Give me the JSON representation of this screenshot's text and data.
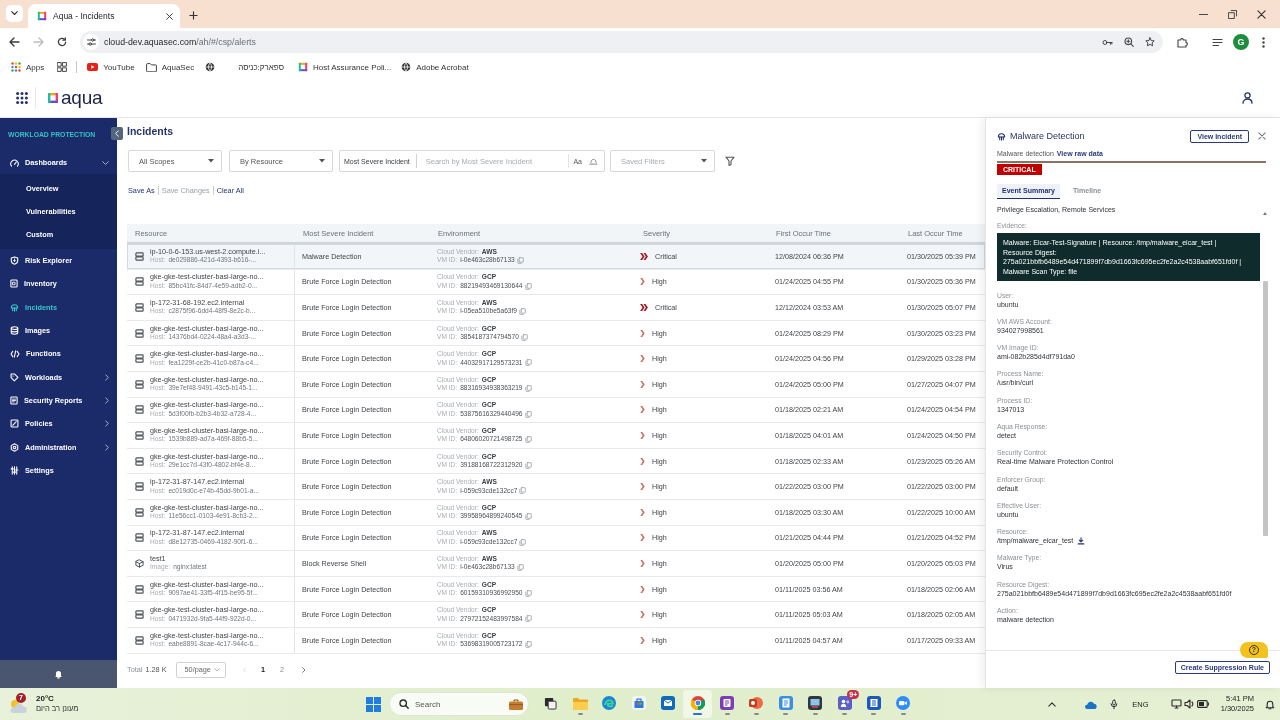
{
  "browser": {
    "tabs": [
      {
        "title": "Aqua - Incidents",
        "selected": true
      }
    ],
    "back_disabled": false,
    "forward_disabled": true,
    "address": {
      "host": "cloud-dev.aquasec.com",
      "path": "/ah/#/csp/alerts"
    },
    "profile_initial": "G",
    "bookmarks": [
      {
        "label": "Apps"
      },
      {
        "label": "YouTube"
      },
      {
        "label": "AquaSec"
      },
      {
        "label": "ספארק:כניסה"
      },
      {
        "label": "Host Assurance Poli..."
      },
      {
        "label": "Adobe Acrobat"
      }
    ]
  },
  "app": {
    "logo": "aqua"
  },
  "sidebar": {
    "section": "WORKLOAD PROTECTION",
    "items": [
      {
        "label": "Dashboards",
        "selected": false,
        "expanded": true,
        "children": [
          {
            "label": "Overview",
            "selected": false
          },
          {
            "label": "Vulnerabilities",
            "selected": false
          },
          {
            "label": "Custom",
            "selected": false
          }
        ]
      },
      {
        "label": "Risk Explorer",
        "selected": false
      },
      {
        "label": "Inventory",
        "selected": false
      },
      {
        "label": "Incidents",
        "selected": true
      },
      {
        "label": "Images",
        "selected": false
      },
      {
        "label": "Functions",
        "selected": false
      },
      {
        "label": "Workloads",
        "selected": false,
        "expanded": false
      },
      {
        "label": "Security Reports",
        "selected": false,
        "expanded": false
      },
      {
        "label": "Policies",
        "selected": false,
        "expanded": false
      },
      {
        "label": "Administration",
        "selected": false,
        "expanded": false
      },
      {
        "label": "Settings",
        "selected": false
      }
    ]
  },
  "incidents": {
    "title": "Incidents",
    "filters": {
      "scope": "All Scopes",
      "group_by": "By Resource",
      "search_field": "Most Severe Incident",
      "search_placeholder": "Search by Most Severe Incident",
      "match_case": "Aa",
      "saved_filters_placeholder": "Saved Filters"
    },
    "actions": [
      {
        "label": "Save As",
        "disabled": false
      },
      {
        "label": "Save Changes",
        "disabled": true
      },
      {
        "label": "Clear All",
        "disabled": false
      }
    ],
    "table": {
      "columns": [
        "Resource",
        "Most Severe Incident",
        "Environment",
        "Severity",
        "First Occur Time",
        "Last Occur Time"
      ],
      "rows": [
        {
          "selected": true,
          "resource": {
            "kind": "host",
            "name": "ip-10-0-6-153.us-west-2.compute.i...",
            "detail_label": "Host:",
            "detail": "de029886-421d-4393-b616-..."
          },
          "incident": "Malware Detection",
          "environment": {
            "vendor_label": "Cloud Vendor:",
            "vendor": "AWS",
            "id_label": "VM ID:",
            "id": "i-0e463c28b67133"
          },
          "severity": {
            "kind": "critical",
            "label": "Critical"
          },
          "first_occur": "12/08/2024 06:36 PM",
          "last_occur": "01/30/2025 05:39 PM"
        },
        {
          "selected": false,
          "resource": {
            "kind": "host",
            "name": "gke-gke-test-cluster-basi-large-no...",
            "detail_label": "Host:",
            "detail": "85bc41fc-84d7-4e59-adb2-0..."
          },
          "incident": "Brute Force Login Detection",
          "environment": {
            "vendor_label": "Cloud Vendor:",
            "vendor": "GCP",
            "id_label": "VM ID:",
            "id": "88219493469130644"
          },
          "severity": {
            "kind": "high",
            "label": "High"
          },
          "first_occur": "01/24/2025 04:55 PM",
          "last_occur": "01/30/2025 05:36 PM"
        },
        {
          "selected": false,
          "resource": {
            "kind": "host",
            "name": "ip-172-31-68-192.ec2.internal",
            "detail_label": "Host:",
            "detail": "c2875f96-6dd4-48f9-8e2c-b..."
          },
          "incident": "Brute Force Login Detection",
          "environment": {
            "vendor_label": "Cloud Vendor:",
            "vendor": "AWS",
            "id_label": "VM ID:",
            "id": "i-05ea510be5a63f9"
          },
          "severity": {
            "kind": "critical",
            "label": "Critical"
          },
          "first_occur": "12/12/2024 03:53 AM",
          "last_occur": "01/30/2025 05:07 PM"
        },
        {
          "selected": false,
          "resource": {
            "kind": "host",
            "name": "gke-gke-test-cluster-basi-large-no...",
            "detail_label": "Host:",
            "detail": "14376bd4-0224-48a4-a3d3-..."
          },
          "incident": "Brute Force Login Detection",
          "environment": {
            "vendor_label": "Cloud Vendor:",
            "vendor": "GCP",
            "id_label": "VM ID:",
            "id": "3854187374794570"
          },
          "severity": {
            "kind": "high",
            "label": "High"
          },
          "first_occur": "01/24/2025 08:29 PM",
          "last_occur": "01/30/2025 03:23 PM"
        },
        {
          "selected": false,
          "resource": {
            "kind": "host",
            "name": "gke-gke-test-cluster-basi-large-no...",
            "detail_label": "Host:",
            "detail": "fea1229f-ce2b-41c0-b87a-c4..."
          },
          "incident": "Brute Force Login Detection",
          "environment": {
            "vendor_label": "Cloud Vendor:",
            "vendor": "GCP",
            "id_label": "VM ID:",
            "id": "44032917129573231"
          },
          "severity": {
            "kind": "high",
            "label": "High"
          },
          "first_occur": "01/24/2025 04:56 PM",
          "last_occur": "01/29/2025 03:28 PM"
        },
        {
          "selected": false,
          "resource": {
            "kind": "host",
            "name": "gke-gke-test-cluster-basi-large-no...",
            "detail_label": "Host:",
            "detail": "39e7ef48-9491-43c5-b145-1..."
          },
          "incident": "Brute Force Login Detection",
          "environment": {
            "vendor_label": "Cloud Vendor:",
            "vendor": "GCP",
            "id_label": "VM ID:",
            "id": "88316934938363219"
          },
          "severity": {
            "kind": "high",
            "label": "High"
          },
          "first_occur": "01/24/2025 05:00 PM",
          "last_occur": "01/27/2025 04:07 PM"
        },
        {
          "selected": false,
          "resource": {
            "kind": "host",
            "name": "gke-gke-test-cluster-basi-large-no...",
            "detail_label": "Host:",
            "detail": "5d3f00fb-b2b3-4b32-a728-4..."
          },
          "incident": "Brute Force Login Detection",
          "environment": {
            "vendor_label": "Cloud Vendor:",
            "vendor": "GCP",
            "id_label": "VM ID:",
            "id": "53875616329440496"
          },
          "severity": {
            "kind": "high",
            "label": "High"
          },
          "first_occur": "01/18/2025 02:21 AM",
          "last_occur": "01/24/2025 04:54 PM"
        },
        {
          "selected": false,
          "resource": {
            "kind": "host",
            "name": "gke-gke-test-cluster-basi-large-no...",
            "detail_label": "Host:",
            "detail": "1539b889-ad7a-469f-88b5-5..."
          },
          "incident": "Brute Force Login Detection",
          "environment": {
            "vendor_label": "Cloud Vendor:",
            "vendor": "GCP",
            "id_label": "VM ID:",
            "id": "64806020721498725"
          },
          "severity": {
            "kind": "high",
            "label": "High"
          },
          "first_occur": "01/18/2025 04:01 AM",
          "last_occur": "01/24/2025 04:50 PM"
        },
        {
          "selected": false,
          "resource": {
            "kind": "host",
            "name": "gke-gke-test-cluster-basi-large-no...",
            "detail_label": "Host:",
            "detail": "29e1cc7d-43f0-4802-bf4e-8..."
          },
          "incident": "Brute Force Login Detection",
          "environment": {
            "vendor_label": "Cloud Vendor:",
            "vendor": "GCP",
            "id_label": "VM ID:",
            "id": "39188168722312920"
          },
          "severity": {
            "kind": "high",
            "label": "High"
          },
          "first_occur": "01/18/2025 02:33 AM",
          "last_occur": "01/23/2025 05:26 AM"
        },
        {
          "selected": false,
          "resource": {
            "kind": "host",
            "name": "ip-172-31-87-147.ec2.internal",
            "detail_label": "Host:",
            "detail": "ec019d0c-e74b-45dd-9b01-a..."
          },
          "incident": "Brute Force Login Detection",
          "environment": {
            "vendor_label": "Cloud Vendor:",
            "vendor": "AWS",
            "id_label": "VM ID:",
            "id": "i-059c93cde132cc7"
          },
          "severity": {
            "kind": "high",
            "label": "High"
          },
          "first_occur": "01/22/2025 03:00 PM",
          "last_occur": "01/22/2025 03:00 PM"
        },
        {
          "selected": false,
          "resource": {
            "kind": "host",
            "name": "gke-gke-test-cluster-basi-large-no...",
            "detail_label": "Host:",
            "detail": "11e56cc1-0103-4e91-8cb3-2..."
          },
          "incident": "Brute Force Login Detection",
          "environment": {
            "vendor_label": "Cloud Vendor:",
            "vendor": "GCP",
            "id_label": "VM ID:",
            "id": "39958964899240545"
          },
          "severity": {
            "kind": "high",
            "label": "High"
          },
          "first_occur": "01/18/2025 03:30 AM",
          "last_occur": "01/22/2025 10:00 AM"
        },
        {
          "selected": false,
          "resource": {
            "kind": "host",
            "name": "ip-172-31-87-147.ec2.internal",
            "detail_label": "Host:",
            "detail": "d8e12735-0469-4182-90f1-6..."
          },
          "incident": "Brute Force Login Detection",
          "environment": {
            "vendor_label": "Cloud Vendor:",
            "vendor": "AWS",
            "id_label": "VM ID:",
            "id": "i-059c93cde132cc7"
          },
          "severity": {
            "kind": "high",
            "label": "High"
          },
          "first_occur": "01/21/2025 04:44 PM",
          "last_occur": "01/21/2025 04:52 PM"
        },
        {
          "selected": false,
          "resource": {
            "kind": "image",
            "name": "test1",
            "detail_label": "Image:",
            "detail": "nginx:latest"
          },
          "incident": "Block Reverse Shell",
          "environment": {
            "vendor_label": "Cloud Vendor:",
            "vendor": "AWS",
            "id_label": "VM ID:",
            "id": "i-0e463c28b67133"
          },
          "severity": {
            "kind": "high",
            "label": "High"
          },
          "first_occur": "01/20/2025 05:00 PM",
          "last_occur": "01/20/2025 05:03 PM"
        },
        {
          "selected": false,
          "resource": {
            "kind": "host",
            "name": "gke-gke-test-cluster-basi-large-no...",
            "detail_label": "Host:",
            "detail": "9097ae41-33f5-4f15-be95-5f..."
          },
          "incident": "Brute Force Login Detection",
          "environment": {
            "vendor_label": "Cloud Vendor:",
            "vendor": "GCP",
            "id_label": "VM ID:",
            "id": "60159310936992950"
          },
          "severity": {
            "kind": "high",
            "label": "High"
          },
          "first_occur": "01/11/2025 03:56 AM",
          "last_occur": "01/18/2025 02:06 AM"
        },
        {
          "selected": false,
          "resource": {
            "kind": "host",
            "name": "gke-gke-test-cluster-basi-large-no...",
            "detail_label": "Host:",
            "detail": "0471932d-9fa5-44f9-922d-0..."
          },
          "incident": "Brute Force Login Detection",
          "environment": {
            "vendor_label": "Cloud Vendor:",
            "vendor": "GCP",
            "id_label": "VM ID:",
            "id": "27972152483997584"
          },
          "severity": {
            "kind": "high",
            "label": "High"
          },
          "first_occur": "01/11/2025 05:03 AM",
          "last_occur": "01/18/2025 02:05 AM"
        },
        {
          "selected": false,
          "resource": {
            "kind": "host",
            "name": "gke-gke-test-cluster-basi-large-no...",
            "detail_label": "Host:",
            "detail": "eabe8891-8cae-4c17-944c-6..."
          },
          "incident": "Brute Force Login Detection",
          "environment": {
            "vendor_label": "Cloud Vendor:",
            "vendor": "GCP",
            "id_label": "VM ID:",
            "id": "53698319005723172"
          },
          "severity": {
            "kind": "high",
            "label": "High"
          },
          "first_occur": "01/11/2025 04:57 AM",
          "last_occur": "01/17/2025 09:33 AM"
        }
      ]
    },
    "pagination": {
      "total_label": "Total",
      "total": "1.28 K",
      "page_size": "50/page",
      "prev_disabled": true,
      "next_disabled": false,
      "pages": [
        {
          "label": "1",
          "selected": true
        },
        {
          "label": "2",
          "selected": false
        }
      ]
    }
  },
  "detail": {
    "title": "Malware Detection",
    "view_button": "View Incident",
    "description": "Malware detection",
    "raw_data_link": "View raw data",
    "severity": {
      "kind": "critical",
      "label": "CRITICAL"
    },
    "tabs": [
      {
        "label": "Event Summary",
        "selected": true
      },
      {
        "label": "Timeline",
        "selected": false
      }
    ],
    "techniques": "Privilege Escalation, Remote Services",
    "evidence_label": "Evidence:",
    "evidence": "Malware: Eicar-Test-Signature | Resource: /tmp/malware_eicar_test | Resource Digest: 275a021bbfb6489e54d471899f7db9d1663fc695ec2fe2a2c4538aabf651fd0f | Malware Scan Type: file",
    "fields": [
      {
        "kind": "text",
        "label": "User:",
        "value": "ubuntu"
      },
      {
        "kind": "text",
        "label": "VM AWS Account:",
        "value": "934027998561"
      },
      {
        "kind": "text",
        "label": "VM Image ID:",
        "value": "ami-082b285d4df791da0"
      },
      {
        "kind": "text",
        "label": "Process Name:",
        "value": "/usr/bin/curl"
      },
      {
        "kind": "text",
        "label": "Process ID:",
        "value": "1347013"
      },
      {
        "kind": "text",
        "label": "Aqua Response:",
        "value": "detect"
      },
      {
        "kind": "text",
        "label": "Security Control:",
        "value": "Real-time Malware Protection Control"
      },
      {
        "kind": "text",
        "label": "Enforcer Group:",
        "value": "default"
      },
      {
        "kind": "text",
        "label": "Effective User:",
        "value": "ubuntu"
      },
      {
        "kind": "download",
        "label": "Resource:",
        "value": "/tmp/malware_eicar_test"
      },
      {
        "kind": "text",
        "label": "Malware Type:",
        "value": "Virus"
      },
      {
        "kind": "text",
        "label": "Resource Digest:",
        "value": "275a021bbfb6489e54d471899f7db9d1663fc695ec2fe2a2c4538aabf651fd0f"
      },
      {
        "kind": "text",
        "label": "Action:",
        "value": "malware detection"
      }
    ],
    "help": "?",
    "footer_button": "Create Suppression Rule"
  },
  "taskbar": {
    "weather": {
      "badge": "7",
      "temperature": "20°C",
      "condition": "מעונן רב היום"
    },
    "search_label": "Search",
    "apps": [
      {
        "open": false,
        "selected": false
      },
      {
        "open": true,
        "selected": false
      },
      {
        "open": false,
        "selected": false
      },
      {
        "open": false,
        "selected": false
      },
      {
        "open": false,
        "selected": false
      },
      {
        "open": true,
        "selected": true
      },
      {
        "open": true,
        "selected": false
      },
      {
        "open": true,
        "selected": false
      },
      {
        "open": true,
        "selected": false
      },
      {
        "open": true,
        "selected": false
      },
      {
        "open": true,
        "selected": false,
        "badge": "9+"
      },
      {
        "open": true,
        "selected": false
      },
      {
        "open": true,
        "selected": false
      }
    ],
    "language": "ENG",
    "time": "5:41 PM",
    "date": "1/30/2025"
  }
}
